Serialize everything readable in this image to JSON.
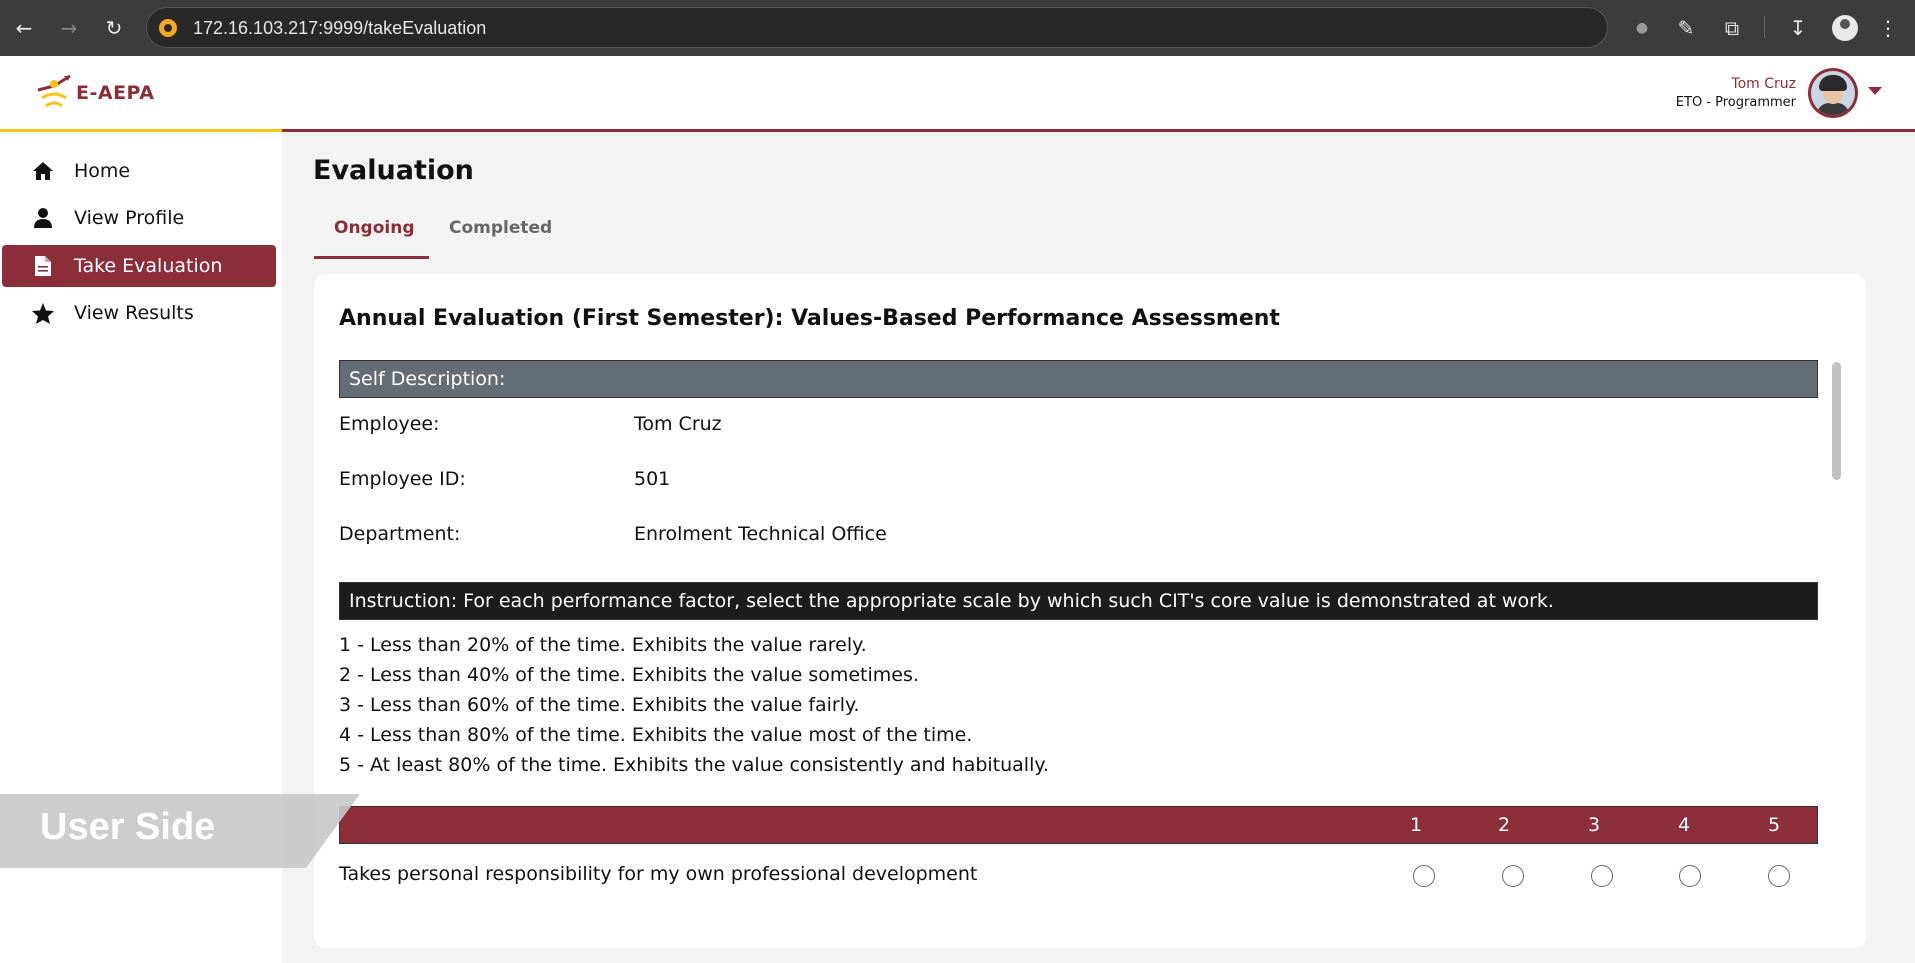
{
  "browser": {
    "url": "172.16.103.217:9999/takeEvaluation"
  },
  "header": {
    "logo_text": "E-AEPA",
    "user_name": "Tom Cruz",
    "user_role": "ETO - Programmer"
  },
  "sidebar": {
    "items": [
      {
        "label": "Home",
        "icon": "home-icon"
      },
      {
        "label": "View Profile",
        "icon": "user-icon"
      },
      {
        "label": "Take Evaluation",
        "icon": "document-icon",
        "active": true
      },
      {
        "label": "View Results",
        "icon": "star-icon"
      }
    ]
  },
  "main": {
    "title": "Evaluation",
    "tabs": [
      {
        "label": "Ongoing",
        "active": true
      },
      {
        "label": "Completed",
        "active": false
      }
    ],
    "card": {
      "title": "Annual Evaluation (First Semester): Values-Based Performance Assessment",
      "self_description_header": "Self Description:",
      "fields": [
        {
          "label": "Employee:",
          "value": "Tom Cruz"
        },
        {
          "label": "Employee ID:",
          "value": "501"
        },
        {
          "label": "Department:",
          "value": "Enrolment Technical Office"
        }
      ],
      "instruction": "Instruction: For each performance factor, select the appropriate scale by which such CIT's core value is demonstrated at work.",
      "scale_descriptions": [
        "1 - Less than 20% of the time. Exhibits the value rarely.",
        "2 - Less than 40% of the time. Exhibits the value sometimes.",
        "3 - Less than 60% of the time. Exhibits the value fairly.",
        "4 - Less than 80% of the time. Exhibits the value most of the time.",
        "5 - At least 80% of the time. Exhibits the value consistently and habitually."
      ],
      "scale_headers": [
        "1",
        "2",
        "3",
        "4",
        "5"
      ],
      "questions": [
        {
          "text": "Takes personal responsibility for my own professional development",
          "selected": null
        }
      ]
    }
  },
  "overlay": {
    "watermark": "User Side"
  },
  "colors": {
    "primary": "#8b2e3a",
    "accent": "#f5c518",
    "section_gray": "#636d73",
    "instruction_dark": "#1c1c1c"
  }
}
